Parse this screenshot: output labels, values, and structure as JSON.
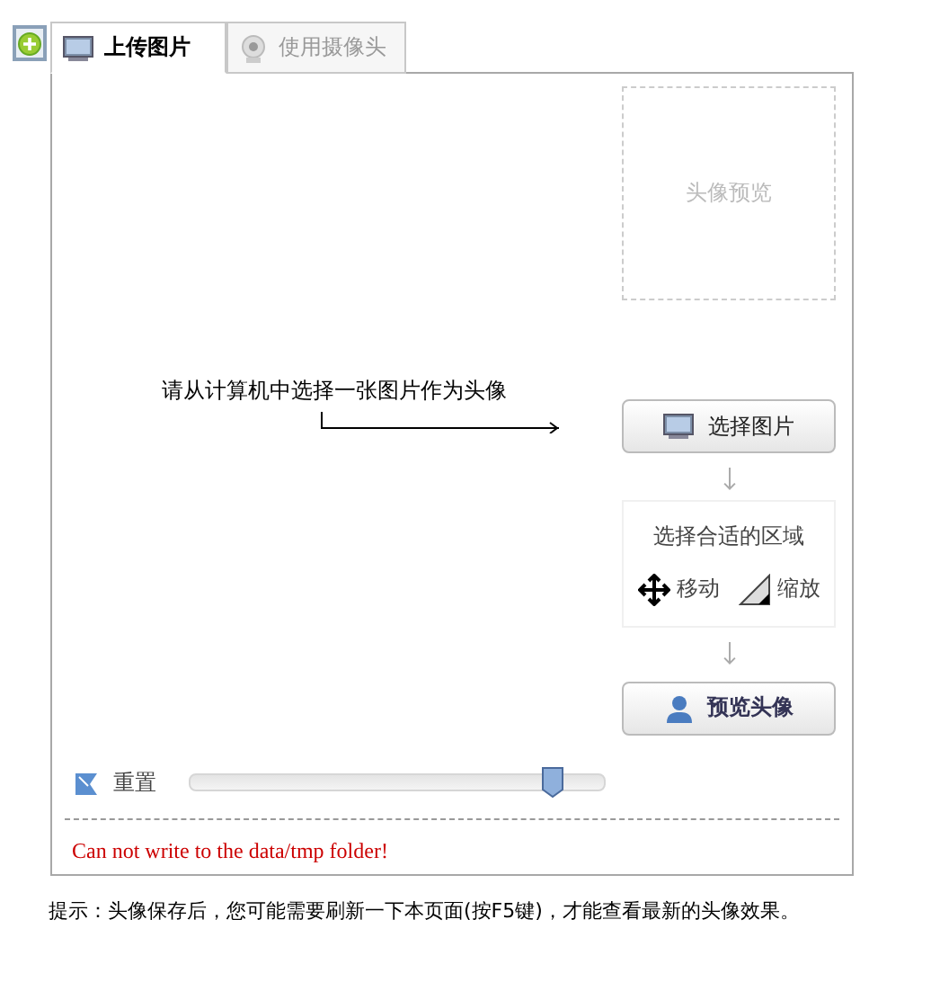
{
  "tabs": [
    {
      "label": "上传图片",
      "selected": true,
      "kind": "upload"
    },
    {
      "label": "使用摄像头",
      "selected": false,
      "kind": "camera"
    }
  ],
  "preview_box": {
    "label": "头像预览"
  },
  "hint": "请从计算机中选择一张图片作为头像",
  "select_button": "选择图片",
  "area_box": {
    "title": "选择合适的区域",
    "move": "移动",
    "zoom": "缩放"
  },
  "preview_button": "预览头像",
  "reset": "重置",
  "zoom_slider": {
    "level": 0.875
  },
  "error": "Can not write to the data/tmp folder!",
  "footer": "提示：头像保存后，您可能需要刷新一下本页面(按F5键)，才能查看最新的头像效果。"
}
